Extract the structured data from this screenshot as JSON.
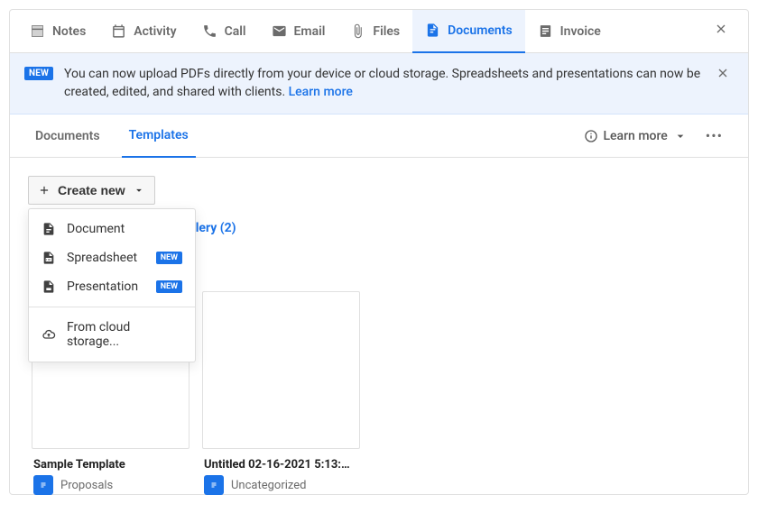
{
  "tabs": {
    "notes": "Notes",
    "activity": "Activity",
    "call": "Call",
    "email": "Email",
    "files": "Files",
    "documents": "Documents",
    "invoice": "Invoice"
  },
  "banner": {
    "badge": "NEW",
    "text": "You can now upload PDFs directly from your device or cloud storage. Spreadsheets and presentations can now be created, edited, and shared with clients. ",
    "link": "Learn more"
  },
  "subtabs": {
    "documents": "Documents",
    "templates": "Templates"
  },
  "rightControls": {
    "learnMore": "Learn more"
  },
  "createButton": "Create new",
  "dropdown": {
    "document": "Document",
    "spreadsheet": "Spreadsheet",
    "presentation": "Presentation",
    "cloud": "From cloud storage...",
    "newBadge": "NEW"
  },
  "galleryLink": "llery (2)",
  "cards": [
    {
      "title": "Sample Template",
      "category": "Proposals"
    },
    {
      "title": "Untitled 02-16-2021 5:13:…",
      "category": "Uncategorized"
    }
  ]
}
